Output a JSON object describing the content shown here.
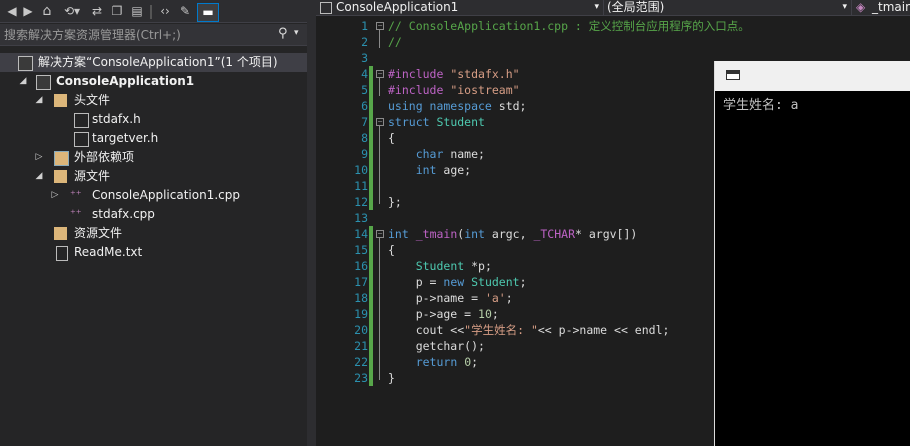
{
  "solution_explorer": {
    "search_placeholder": "搜索解决方案资源管理器(Ctrl+;)",
    "tree": [
      {
        "label": "解决方案“ConsoleApplication1”(1 个项目)",
        "icon": "solution-icon"
      },
      {
        "label": "ConsoleApplication1",
        "icon": "cpp-project-icon"
      },
      {
        "label": "头文件",
        "icon": "folder-icon"
      },
      {
        "label": "stdafx.h",
        "icon": "header-file-icon"
      },
      {
        "label": "targetver.h",
        "icon": "header-file-icon"
      },
      {
        "label": "外部依赖项",
        "icon": "external-deps-icon"
      },
      {
        "label": "源文件",
        "icon": "folder-icon"
      },
      {
        "label": "ConsoleApplication1.cpp",
        "icon": "cpp-file-icon"
      },
      {
        "label": "stdafx.cpp",
        "icon": "cpp-file-icon"
      },
      {
        "label": "资源文件",
        "icon": "folder-icon"
      },
      {
        "label": "ReadMe.txt",
        "icon": "text-file-icon"
      }
    ]
  },
  "editor": {
    "project_dropdown": "ConsoleApplication1",
    "scope_dropdown": "(全局范围)",
    "member_dropdown": "_tmain",
    "line_numbers": [
      "1",
      "2",
      "3",
      "4",
      "5",
      "6",
      "7",
      "8",
      "9",
      "10",
      "11",
      "12",
      "13",
      "14",
      "15",
      "16",
      "17",
      "18",
      "19",
      "20",
      "21",
      "22",
      "23"
    ]
  },
  "console": {
    "output": "学生姓名: a"
  },
  "colors": {
    "accent_green": "#57a64a",
    "keyword": "#569cd6",
    "type": "#4ec9b0",
    "string": "#d69d85",
    "comment": "#57a64a",
    "line_number": "#2b91af"
  }
}
